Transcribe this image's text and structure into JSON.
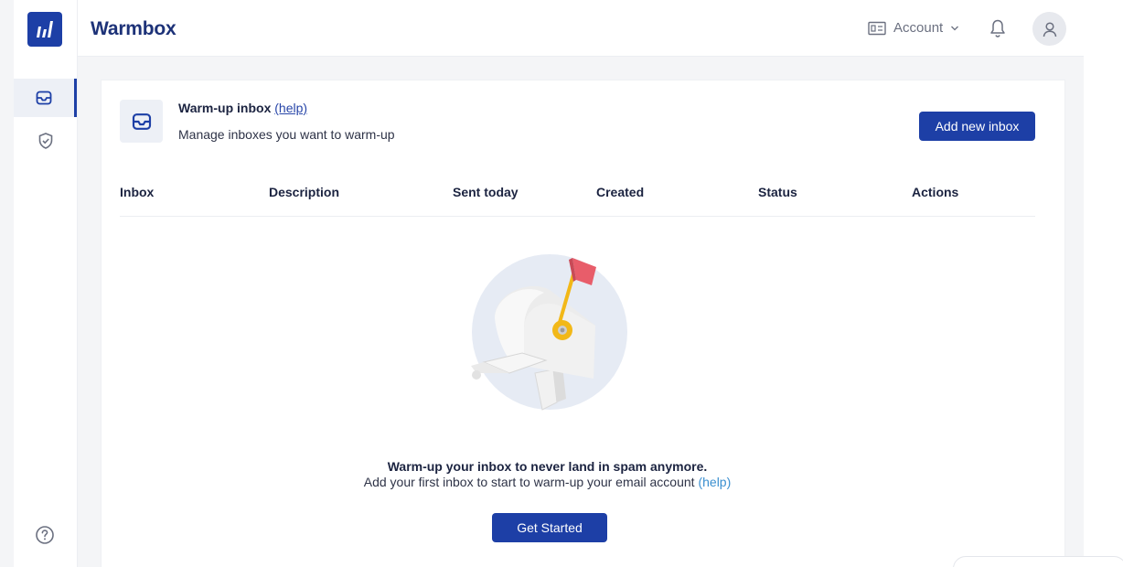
{
  "app": {
    "name": "Warmbox"
  },
  "sidebar": {
    "items": [
      {
        "icon": "inbox-icon",
        "active": true
      },
      {
        "icon": "shield-check-icon",
        "active": false
      }
    ],
    "help_icon": "help-circle-icon"
  },
  "topbar": {
    "account_label": "Account",
    "icons": [
      "id-card-icon",
      "chevron-down-icon",
      "bell-icon",
      "user-icon"
    ]
  },
  "header": {
    "title": "Warm-up inbox",
    "help_link": "(help)",
    "subtitle": "Manage inboxes you want to warm-up",
    "add_button": "Add new inbox"
  },
  "table": {
    "columns": [
      "Inbox",
      "Description",
      "Sent today",
      "Created",
      "Status",
      "Actions"
    ],
    "rows": []
  },
  "empty_state": {
    "title": "Warm-up your inbox to never land in spam anymore.",
    "subtitle": "Add your first inbox to start to warm-up your email account",
    "help_link": "(help)",
    "button": "Get Started"
  },
  "colors": {
    "primary": "#1d3fa6",
    "brand_text": "#1d3278",
    "link": "#3a8fd0",
    "flag": "#e85d6a",
    "accent_yellow": "#f2b818"
  }
}
